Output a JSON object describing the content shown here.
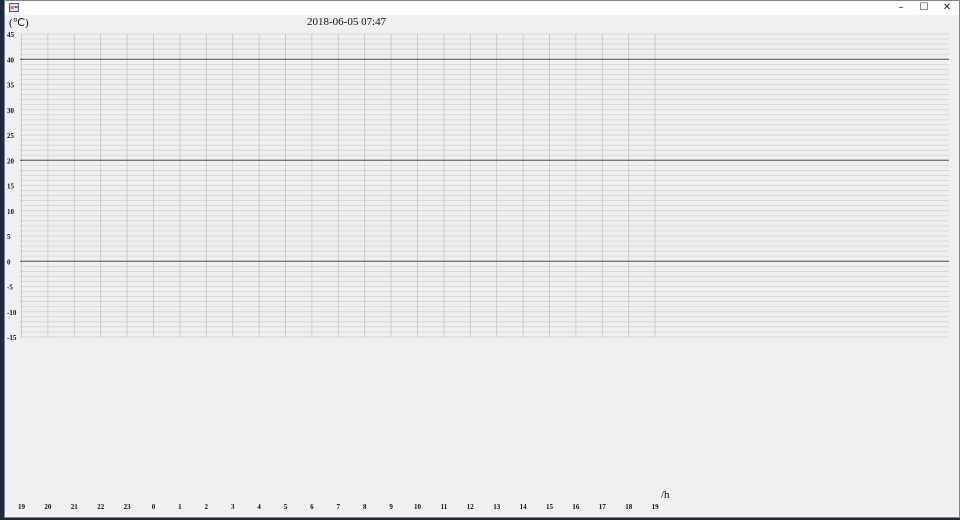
{
  "window": {
    "title": "",
    "minimize_glyph": "–",
    "maximize_glyph": "☐",
    "close_glyph": "✕",
    "icon": "app-window-icon"
  },
  "header": {
    "unit_label": "(℃)",
    "datetime": "2018-06-05   07:47"
  },
  "footer": {
    "hour_unit": "/h"
  },
  "chart_data": {
    "type": "line",
    "y_tick_labels": [
      "45",
      "40",
      "35",
      "30",
      "25",
      "20",
      "15",
      "10",
      "5",
      "0",
      "-5",
      "-10",
      "-15"
    ],
    "ylim": [
      -15,
      45
    ],
    "x_tick_labels": [
      "19",
      "20",
      "21",
      "22",
      "23",
      "0",
      "1",
      "2",
      "3",
      "4",
      "5",
      "6",
      "7",
      "8",
      "9",
      "10",
      "11",
      "12",
      "13",
      "14",
      "15",
      "16",
      "17",
      "18",
      "19"
    ],
    "grid": true,
    "series": []
  }
}
